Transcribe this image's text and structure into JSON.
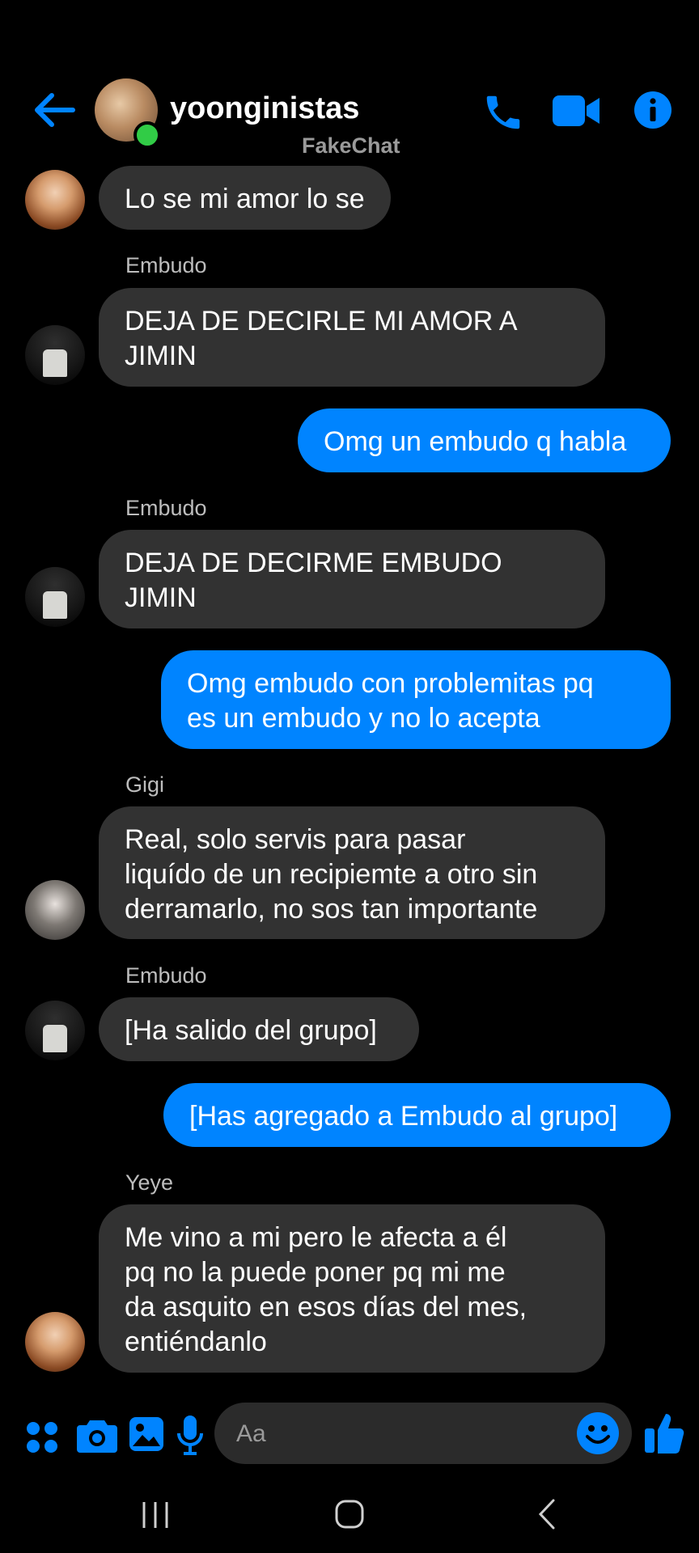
{
  "header": {
    "title": "yoonginistas",
    "watermark": "FakeChat",
    "accent": "#0084ff"
  },
  "messages": [
    {
      "direction": "in",
      "text": "Lo se mi amor lo se"
    },
    {
      "direction": "in",
      "sender": "Embudo",
      "text": "DEJA DE DECIRLE MI AMOR A\nJIMIN"
    },
    {
      "direction": "out",
      "text": "Omg un embudo q habla"
    },
    {
      "direction": "in",
      "sender": "Embudo",
      "text": "DEJA DE DECIRME EMBUDO\nJIMIN"
    },
    {
      "direction": "out",
      "text": "Omg embudo con problemitas pq\nes un embudo y no lo acepta"
    },
    {
      "direction": "in",
      "sender": "Gigi",
      "text": "Real, solo servis para pasar\nliquído de un recipiemte a otro sin\nderramarlo, no sos tan importante"
    },
    {
      "direction": "in",
      "sender": "Embudo",
      "text": "[Ha salido del grupo]"
    },
    {
      "direction": "out",
      "text": "[Has agregado a Embudo al grupo]"
    },
    {
      "direction": "in",
      "sender": "Yeye",
      "text": "Me vino a mi pero le afecta a él\npq no la puede poner pq mi me\nda asquito en esos días del mes,\nentiéndanlo"
    }
  ],
  "composer": {
    "placeholder": "Aa"
  },
  "colors": {
    "incoming_bubble": "#323232",
    "outgoing_bubble": "#0084ff",
    "online": "#31cc46"
  }
}
